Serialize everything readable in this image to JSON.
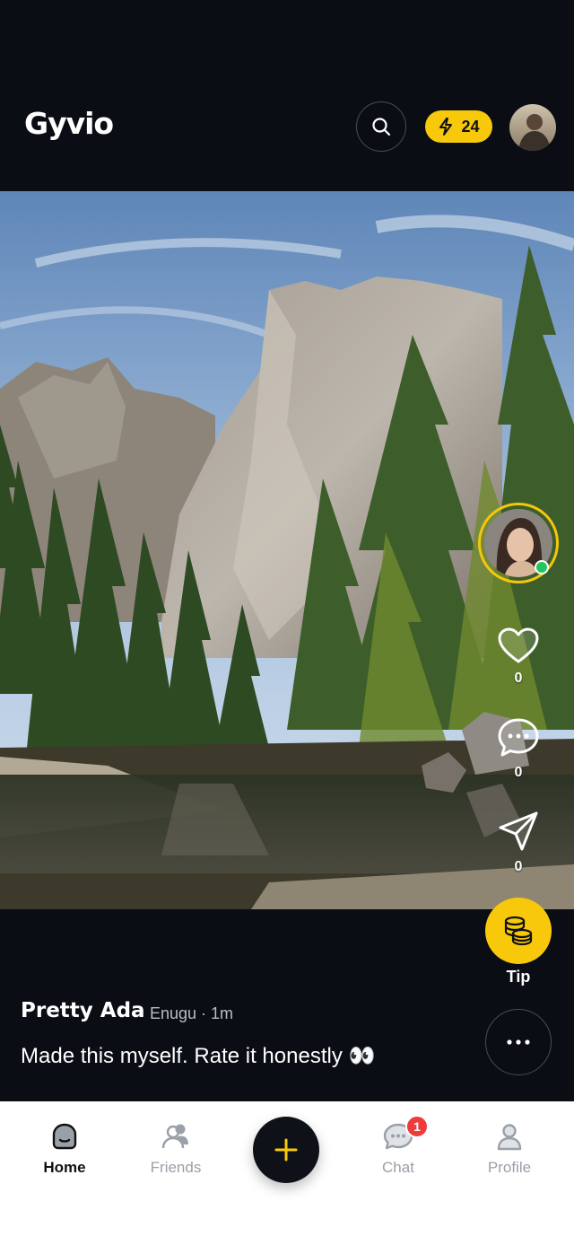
{
  "app": {
    "title": "Gyvio"
  },
  "header": {
    "credits": "24"
  },
  "post": {
    "author": "Pretty Ada",
    "meta": "Enugu · 1m",
    "caption": "Made this myself. Rate it honestly 👀",
    "likes": "0",
    "comments": "0",
    "shares": "0",
    "tip_label": "Tip"
  },
  "nav": {
    "home": "Home",
    "friends": "Friends",
    "chat": "Chat",
    "profile": "Profile",
    "chat_badge": "1"
  },
  "colors": {
    "accent": "#f8c90b",
    "background": "#0a0d14",
    "online": "#22c55e",
    "badge": "#ef3b3b"
  },
  "icons": [
    "search-icon",
    "bolt-icon",
    "heart-icon",
    "comment-icon",
    "share-icon",
    "coins-icon",
    "more-icon",
    "home-icon",
    "friends-icon",
    "plus-icon",
    "chat-icon",
    "profile-icon"
  ]
}
